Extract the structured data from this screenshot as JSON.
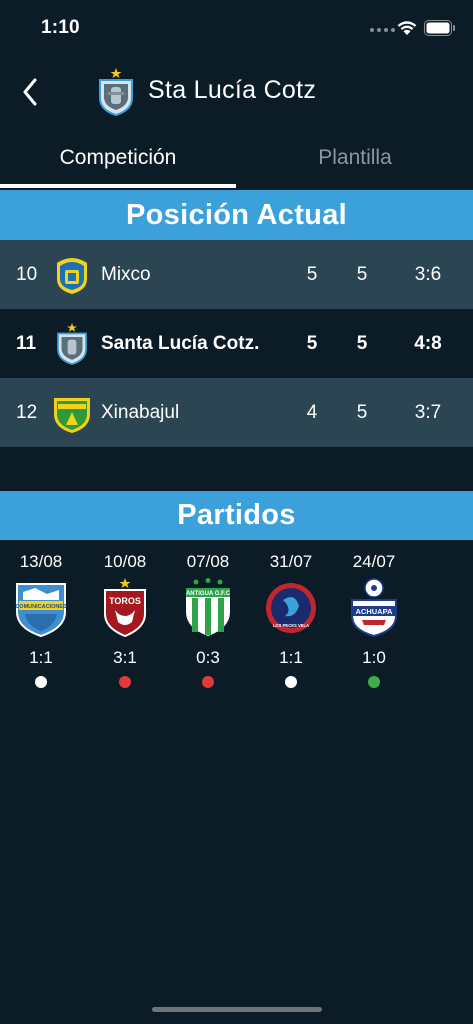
{
  "status_bar": {
    "time": "1:10"
  },
  "header": {
    "title": "Sta Lucía Cotz",
    "icons": {
      "back": "chevron-left-icon",
      "crest": "team-crest-icon"
    }
  },
  "tabs": [
    {
      "label": "Competición",
      "active": true
    },
    {
      "label": "Plantilla",
      "active": false
    }
  ],
  "standings": {
    "title": "Posición Actual",
    "rows": [
      {
        "pos": "10",
        "team": "Mixco",
        "played": "5",
        "points": "5",
        "goals": "3:6"
      },
      {
        "pos": "11",
        "team": "Santa Lucía Cotz.",
        "played": "5",
        "points": "5",
        "goals": "4:8"
      },
      {
        "pos": "12",
        "team": "Xinabajul",
        "played": "4",
        "points": "5",
        "goals": "3:7"
      }
    ]
  },
  "matches": {
    "title": "Partidos",
    "items": [
      {
        "date": "13/08",
        "score": "1:1",
        "logo_text": "COMUNICACIONES",
        "result_color": "#ffffff"
      },
      {
        "date": "10/08",
        "score": "3:1",
        "logo_text": "TOROS",
        "result_color": "#e03a3a"
      },
      {
        "date": "07/08",
        "score": "0:3",
        "logo_text": "ANTIGUA G.F.C",
        "result_color": "#e03a3a"
      },
      {
        "date": "31/07",
        "score": "1:1",
        "logo_text": "LOS PECES VELA",
        "result_color": "#ffffff"
      },
      {
        "date": "24/07",
        "score": "1:0",
        "logo_text": "ACHUAPA",
        "result_color": "#3fae49"
      }
    ]
  },
  "colors": {
    "background": "#0c1c27",
    "banner": "#3ca0db",
    "row_alt": "#2b4552",
    "win": "#3fae49",
    "loss": "#e03a3a",
    "draw": "#ffffff"
  }
}
